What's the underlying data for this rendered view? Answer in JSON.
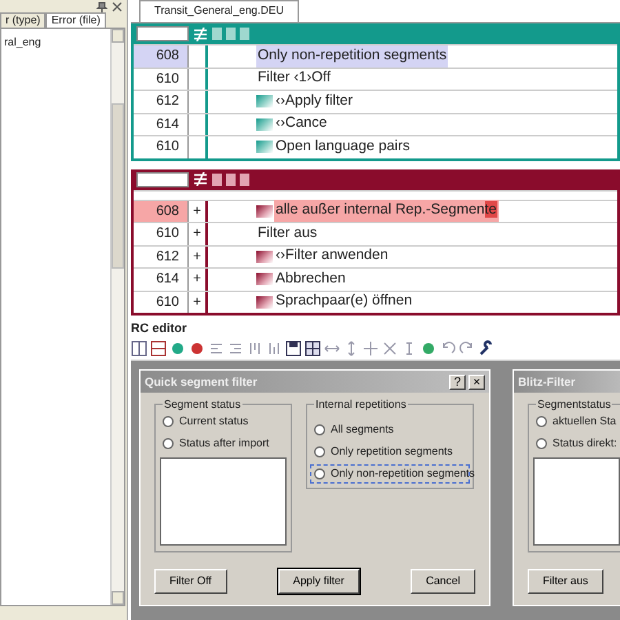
{
  "left_panel": {
    "tabs": [
      {
        "label": "r (type)",
        "selected": false
      },
      {
        "label": "Error (file)",
        "selected": true
      }
    ],
    "items": [
      {
        "label": "ral_eng"
      }
    ]
  },
  "document_tab": {
    "title": "Transit_General_eng.DEU"
  },
  "source_pane": {
    "rows": [
      {
        "number": "608",
        "mark": "",
        "text": "Only non-repetition segments",
        "selected": true,
        "tag": false
      },
      {
        "number": "610",
        "mark": "",
        "text": "Filter ‹1›Off",
        "selected": false,
        "tag": false
      },
      {
        "number": "612",
        "mark": "",
        "text": "‹›Apply filter",
        "selected": false,
        "tag": true
      },
      {
        "number": "614",
        "mark": "",
        "text": "‹›Cance",
        "selected": false,
        "tag": true
      },
      {
        "number": "610",
        "mark": "",
        "text": "Open language pairs",
        "selected": false,
        "tag": true
      }
    ]
  },
  "target_pane": {
    "rows": [
      {
        "number": "608",
        "mark": "+",
        "text": "alle außer internal Rep.-Segmen",
        "error": "te",
        "selected": true,
        "tag": true
      },
      {
        "number": "610",
        "mark": "+",
        "text": "Filter aus",
        "selected": false,
        "tag": false
      },
      {
        "number": "612",
        "mark": "+",
        "text": "‹›Filter anwenden",
        "selected": false,
        "tag": true
      },
      {
        "number": "614",
        "mark": "+",
        "text": "Abbrechen",
        "selected": false,
        "tag": true
      },
      {
        "number": "610",
        "mark": "+",
        "text": "Sprachpaar(e) öffnen",
        "selected": false,
        "tag": true
      }
    ]
  },
  "editor": {
    "title": "RC editor",
    "dialogs": [
      {
        "title": "Quick segment filter",
        "help": "?",
        "close": "×",
        "groups": [
          {
            "title": "Segment status",
            "listbox": true,
            "options": [
              {
                "label": "Current status",
                "checked": false
              },
              {
                "label": "Status after import",
                "checked": false
              }
            ]
          },
          {
            "title": "Internal repetitions",
            "listbox": false,
            "options": [
              {
                "label": "All segments",
                "checked": false
              },
              {
                "label": "Only repetition segments",
                "checked": false
              },
              {
                "label": "Only non-repetition segments",
                "checked": false,
                "selected": true
              }
            ]
          }
        ],
        "buttons": [
          {
            "label": "Filter Off",
            "default": false
          },
          {
            "label": "Apply filter",
            "default": true
          },
          {
            "label": "Cancel",
            "default": false
          }
        ]
      },
      {
        "title": "Blitz-Filter",
        "groups": [
          {
            "title": "Segmentstatus",
            "listbox": true,
            "options": [
              {
                "label": "aktuellen Sta",
                "checked": false
              },
              {
                "label": "Status direkt:",
                "checked": false
              }
            ]
          }
        ],
        "buttons": [
          {
            "label": "Filter aus",
            "default": false
          }
        ]
      }
    ]
  }
}
